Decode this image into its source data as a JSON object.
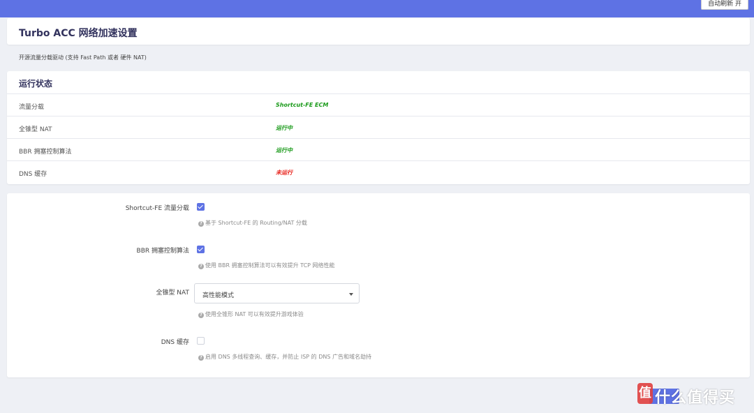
{
  "header": {
    "auto_refresh": "自动刷新 开"
  },
  "page": {
    "title": "Turbo ACC 网络加速设置",
    "description": "开源流量分载驱动 (支持 Fast Path 或者 硬件 NAT)"
  },
  "status": {
    "title": "运行状态",
    "rows": [
      {
        "label": "流量分载",
        "value": "Shortcut-FE ECM",
        "color": "#1a9a1a"
      },
      {
        "label": "全锥型 NAT",
        "value": "运行中",
        "color": "#1a9a1a"
      },
      {
        "label": "BBR 拥塞控制算法",
        "value": "运行中",
        "color": "#1a9a1a"
      },
      {
        "label": "DNS 缓存",
        "value": "未运行",
        "color": "#e8221b"
      }
    ]
  },
  "settings": {
    "sfe": {
      "label": "Shortcut-FE 流量分载",
      "checked": true,
      "help": "基于 Shortcut-FE 的 Routing/NAT 分载"
    },
    "bbr": {
      "label": "BBR 拥塞控制算法",
      "checked": true,
      "help": "使用 BBR 拥塞控制算法可以有效提升 TCP 网络性能"
    },
    "fullcone": {
      "label": "全锥型 NAT",
      "selected": "高性能模式",
      "help": "使用全锥形 NAT 可以有效提升游戏体验"
    },
    "dns": {
      "label": "DNS 缓存",
      "checked": false,
      "help": "启用 DNS 多线程查询、缓存，并防止 ISP 的 DNS 广告和域名劫持"
    }
  },
  "watermark": {
    "logo": "值",
    "text": "什么值得买"
  },
  "colors": {
    "accent": "#5e72e4",
    "running": "#1a9a1a",
    "stopped": "#e8221b"
  }
}
